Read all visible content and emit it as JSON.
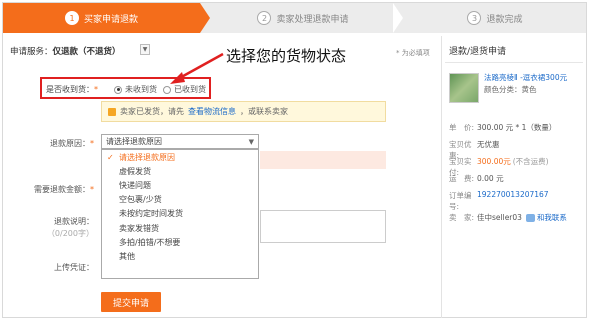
{
  "steps": [
    {
      "num": "1",
      "label": "买家申请退款",
      "active": true
    },
    {
      "num": "2",
      "label": "卖家处理退款申请",
      "active": false
    },
    {
      "num": "3",
      "label": "退款完成",
      "active": false
    }
  ],
  "form": {
    "service_label": "申请服务：",
    "service_value": "仅退款（不退货）",
    "required_hint": "* 为必填项",
    "received_label": "是否收到货：",
    "radio_not_received": "未收到货",
    "radio_received": "已收到货",
    "selected_radio": "未收到货",
    "tip_text_1": "卖家已发货，请先",
    "tip_link": "查看物流信息",
    "tip_text_2": "，或联系卖家",
    "reason_label": "退款原因：",
    "reason_placeholder": "请选择退款原因",
    "reason_options": [
      "请选择退款原因",
      "虚假发货",
      "快递问题",
      "空包裹/少货",
      "未按约定时间发货",
      "卖家发错货",
      "多拍/拍错/不想要",
      "其他"
    ],
    "amount_label": "需要退款金额：",
    "note_label": "退款说明：",
    "note_counter": "（0/200字）",
    "voucher_label": "上传凭证：",
    "submit_label": "提交申请"
  },
  "annotation": "选择您的货物状态",
  "summary": {
    "title": "退款/退货申请",
    "product_name": "法路亮棱Ⅱ -逗衣裙300元",
    "product_color": "颜色分类：黄色",
    "rows": [
      {
        "key": "单　价:",
        "value": "300.00 元 * 1（数量）",
        "style": ""
      },
      {
        "key": "宝贝优惠:",
        "value": "无优惠",
        "style": ""
      },
      {
        "key": "宝贝实付:",
        "value": "300.00元",
        "suffix": "(不含运费)",
        "style": "orange"
      },
      {
        "key": "运　费:",
        "value": "0.00 元",
        "style": ""
      },
      {
        "key": "订单编号:",
        "value": "192270013207167",
        "style": "blue"
      },
      {
        "key": "卖　家:",
        "value": "佳中seller03",
        "style": ""
      }
    ],
    "contact_label": "和我联系"
  },
  "colors": {
    "accent": "#f46d1b",
    "link": "#1b6ac9",
    "highlight_box": "#e02020"
  }
}
